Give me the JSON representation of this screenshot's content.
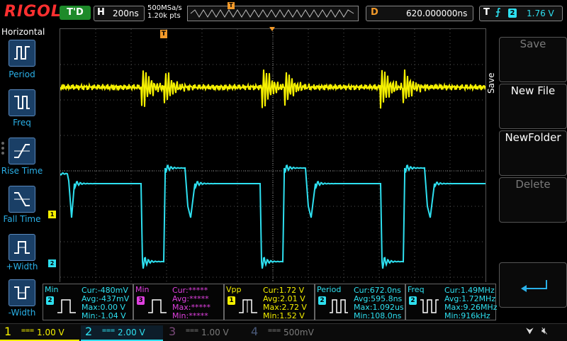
{
  "brand": "RIGOL",
  "run_status": "T'D",
  "horizontal": {
    "key": "H",
    "scale": "200ns"
  },
  "sampling": {
    "rate": "500MSa/s",
    "points": "1.20k pts"
  },
  "delay": {
    "key": "D",
    "value": "620.000000ns"
  },
  "trigger": {
    "key": "T",
    "edge_icon": "rising-edge",
    "channel": "2",
    "level": "1.76 V"
  },
  "left_menu": {
    "title": "Horizontal",
    "items": [
      {
        "label": "Period",
        "icon": "period-icon"
      },
      {
        "label": "Freq",
        "icon": "freq-icon"
      },
      {
        "label": "Rise Time",
        "icon": "rise-time-icon"
      },
      {
        "label": "Fall Time",
        "icon": "fall-time-icon"
      },
      {
        "label": "+Width",
        "icon": "pos-width-icon"
      },
      {
        "label": "-Width",
        "icon": "neg-width-icon"
      }
    ]
  },
  "right_menu": {
    "title": "Save",
    "buttons": [
      {
        "label": "Save",
        "enabled": false
      },
      {
        "label": "New File",
        "enabled": true
      },
      {
        "label": "NewFolder",
        "enabled": true
      },
      {
        "label": "Delete",
        "enabled": false
      }
    ],
    "return_icon": "return-icon"
  },
  "markers": {
    "ch1": "1",
    "ch2": "2",
    "trig_top": "T",
    "trig_right": "T"
  },
  "measurements": [
    {
      "name": "Min",
      "channel": "2",
      "color": "#2ee0f0",
      "cur": "Cur:-480mV",
      "avg": "Avg:-437mV",
      "max": "Max:0.00 V",
      "min": "Min:-1.04 V"
    },
    {
      "name": "Min",
      "channel": "3",
      "color": "#e040e0",
      "cur": "Cur:*****",
      "avg": "Avg:*****",
      "max": "Max:*****",
      "min": "Min:*****"
    },
    {
      "name": "Vpp",
      "channel": "1",
      "color": "#f5f000",
      "cur": "Cur:1.72 V",
      "avg": "Avg:2.01 V",
      "max": "Max:2.72 V",
      "min": "Min:1.52 V"
    },
    {
      "name": "Period",
      "channel": "2",
      "color": "#2ee0f0",
      "cur": "Cur:672.0ns",
      "avg": "Avg:595.8ns",
      "max": "Max:1.092us",
      "min": "Min:108.0ns"
    },
    {
      "name": "Freq",
      "channel": "2",
      "color": "#2ee0f0",
      "cur": "Cur:1.49MHz",
      "avg": "Avg:1.72MHz",
      "max": "Max:9.26MHz",
      "min": "Min:916kHz"
    }
  ],
  "channels": [
    {
      "num": "1",
      "coupling": "===",
      "scale": "1.00 V",
      "color": "#f5f000",
      "active": true
    },
    {
      "num": "2",
      "coupling": "===",
      "scale": "2.00 V",
      "color": "#2ee0f0",
      "active": true
    },
    {
      "num": "3",
      "coupling": "===",
      "scale": "1.00 V",
      "color": "#7a4a7a",
      "active": false
    },
    {
      "num": "4",
      "coupling": "===",
      "scale": "500mV",
      "color": "#4a5a7a",
      "active": false
    }
  ],
  "status_icons": [
    "usb-icon",
    "speaker-mute-icon"
  ],
  "colors": {
    "ch1": "#f5f000",
    "ch2": "#2ee0f0",
    "trigger": "#f39a2a",
    "menu_accent": "#2ab0e8"
  }
}
